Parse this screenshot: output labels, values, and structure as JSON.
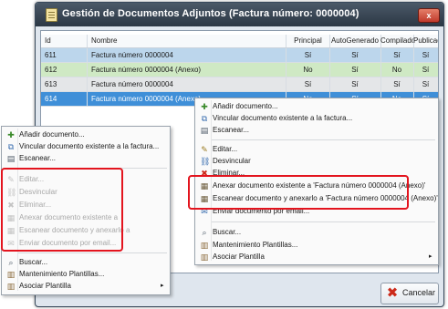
{
  "window": {
    "title": "Gestión de Documentos Adjuntos (Factura número: 0000004)",
    "close_glyph": "x"
  },
  "table": {
    "columns": [
      "Id",
      "Nombre",
      "Principal",
      "AutoGenerado",
      "Compilado",
      "Publicado"
    ],
    "rows": [
      {
        "id": "611",
        "nombre": "Factura número 0000004",
        "principal": "Sí",
        "autogenerado": "Sí",
        "compilado": "Sí",
        "publicado": "Sí",
        "style": "blue"
      },
      {
        "id": "612",
        "nombre": "Factura número 0000004 (Anexo)",
        "principal": "No",
        "autogenerado": "Sí",
        "compilado": "No",
        "publicado": "Sí",
        "style": "green"
      },
      {
        "id": "613",
        "nombre": "Factura número 0000004",
        "principal": "Sí",
        "autogenerado": "Sí",
        "compilado": "Sí",
        "publicado": "Sí",
        "style": "grey"
      },
      {
        "id": "614",
        "nombre": "Factura número 0000004 (Anexo)",
        "principal": "No",
        "autogenerado": "Sí",
        "compilado": "No",
        "publicado": "Sí",
        "style": "selected"
      }
    ]
  },
  "cancel_button": {
    "label": "Cancelar",
    "icon": "cancel-x-icon"
  },
  "context_menu": {
    "items": [
      {
        "label": "Añadir documento...",
        "icon": "add-document-icon"
      },
      {
        "label": "Vincular documento existente a la factura...",
        "icon": "link-document-icon"
      },
      {
        "label": "Escanear...",
        "icon": "scanner-icon"
      },
      {
        "label": "Editar...",
        "icon": "edit-icon"
      },
      {
        "label": "Desvincular",
        "icon": "unlink-icon"
      },
      {
        "label": "Eliminar...",
        "icon": "delete-x-icon"
      },
      {
        "label": "Anexar documento existente a 'Factura número 0000004 (Anexo)'",
        "icon": "attach-document-icon"
      },
      {
        "label": "Escanear documento y anexarlo a 'Factura número 0000004 (Anexo)'",
        "icon": "scan-attach-icon"
      },
      {
        "label": "Enviar documento por email...",
        "icon": "email-icon"
      },
      {
        "label": "Buscar...",
        "icon": "search-icon"
      },
      {
        "label": "Mantenimiento Plantillas...",
        "icon": "templates-icon"
      },
      {
        "label": "Asociar Plantilla",
        "icon": "template-associate-icon"
      }
    ]
  },
  "left_menu": {
    "items": [
      {
        "label": "Añadir documento...",
        "enabled": true
      },
      {
        "label": "Vincular documento existente a la factura...",
        "enabled": true
      },
      {
        "label": "Escanear...",
        "enabled": true
      },
      {
        "label": "Editar...",
        "enabled": false
      },
      {
        "label": "Desvincular",
        "enabled": false
      },
      {
        "label": "Eliminar...",
        "enabled": false
      },
      {
        "label": "Anexar documento existente a",
        "enabled": false
      },
      {
        "label": "Escanear documento y anexarlo a",
        "enabled": false
      },
      {
        "label": "Enviar documento por email...",
        "enabled": false
      },
      {
        "label": "Buscar...",
        "enabled": true
      },
      {
        "label": "Mantenimiento Plantillas...",
        "enabled": true
      },
      {
        "label": "Asociar Plantilla",
        "enabled": true
      }
    ]
  },
  "submenu_arrow": "▸",
  "colors": {
    "highlight": "#e3141e",
    "selection": "#3f8fd8",
    "title_bar": "#2b3744"
  }
}
